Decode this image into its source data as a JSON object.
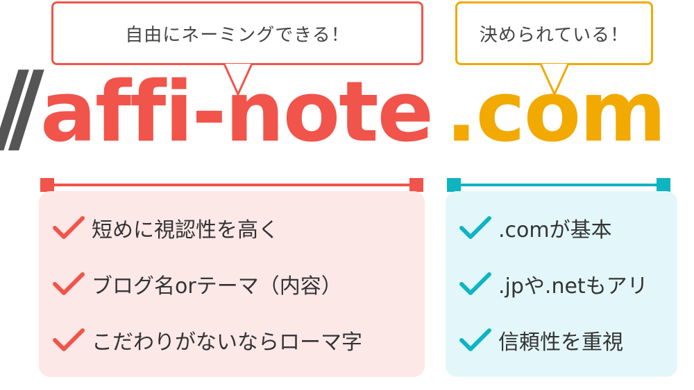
{
  "bubbles": {
    "name_bubble": "自由にネーミングできる！",
    "tld_bubble": "決められている！"
  },
  "domain": {
    "slashes": "//",
    "name": "affi-note",
    "tld": ".com"
  },
  "panels": {
    "name_points": [
      "短めに視認性を高く",
      "ブログ名orテーマ（内容）",
      "こだわりがないならローマ字"
    ],
    "tld_points": [
      ".comが基本",
      ".jpや.netもアリ",
      "信頼性を重視"
    ]
  },
  "colors": {
    "red": "#f1544a",
    "yellow": "#f2a900",
    "cyan": "#0fb4c3",
    "gray": "#555555"
  },
  "icons": {
    "check": "check-icon"
  }
}
